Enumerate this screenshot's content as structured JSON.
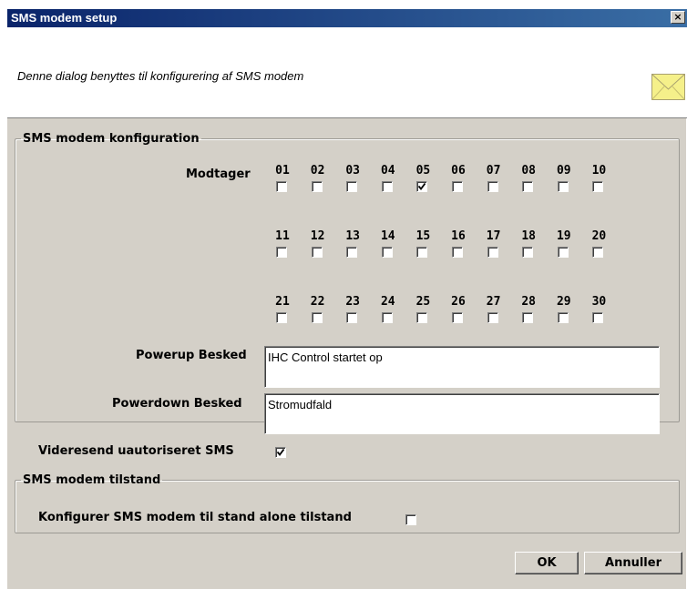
{
  "window": {
    "title": "SMS modem setup",
    "close_glyph": "×"
  },
  "header": {
    "description": "Denne dialog benyttes til konfigurering af SMS modem",
    "icon": "envelope-icon"
  },
  "config_group": {
    "legend": "SMS modem konfiguration",
    "receiver_label": "Modtager",
    "receivers": [
      {
        "num": "01",
        "checked": false
      },
      {
        "num": "02",
        "checked": false
      },
      {
        "num": "03",
        "checked": false
      },
      {
        "num": "04",
        "checked": false
      },
      {
        "num": "05",
        "checked": true
      },
      {
        "num": "06",
        "checked": false
      },
      {
        "num": "07",
        "checked": false
      },
      {
        "num": "08",
        "checked": false
      },
      {
        "num": "09",
        "checked": false
      },
      {
        "num": "10",
        "checked": false
      },
      {
        "num": "11",
        "checked": false
      },
      {
        "num": "12",
        "checked": false
      },
      {
        "num": "13",
        "checked": false
      },
      {
        "num": "14",
        "checked": false
      },
      {
        "num": "15",
        "checked": false
      },
      {
        "num": "16",
        "checked": false
      },
      {
        "num": "17",
        "checked": false
      },
      {
        "num": "18",
        "checked": false
      },
      {
        "num": "19",
        "checked": false
      },
      {
        "num": "20",
        "checked": false
      },
      {
        "num": "21",
        "checked": false
      },
      {
        "num": "22",
        "checked": false
      },
      {
        "num": "23",
        "checked": false
      },
      {
        "num": "24",
        "checked": false
      },
      {
        "num": "25",
        "checked": false
      },
      {
        "num": "26",
        "checked": false
      },
      {
        "num": "27",
        "checked": false
      },
      {
        "num": "28",
        "checked": false
      },
      {
        "num": "29",
        "checked": false
      },
      {
        "num": "30",
        "checked": false
      }
    ],
    "powerup_label": "Powerup Besked",
    "powerup_value": "IHC Control startet op",
    "powerdown_label": "Powerdown Besked",
    "powerdown_value": "Stromudfald",
    "forward_label": "Videresend uautoriseret SMS",
    "forward_checked": true
  },
  "state_group": {
    "legend": "SMS modem tilstand",
    "standalone_label": "Konfigurer SMS modem til stand alone tilstand",
    "standalone_checked": false
  },
  "buttons": {
    "ok": "OK",
    "cancel": "Annuller"
  },
  "colors": {
    "title_bar": "#0a246a",
    "dialog_bg": "#d4d0c8",
    "envelope": "#f5f08a"
  }
}
